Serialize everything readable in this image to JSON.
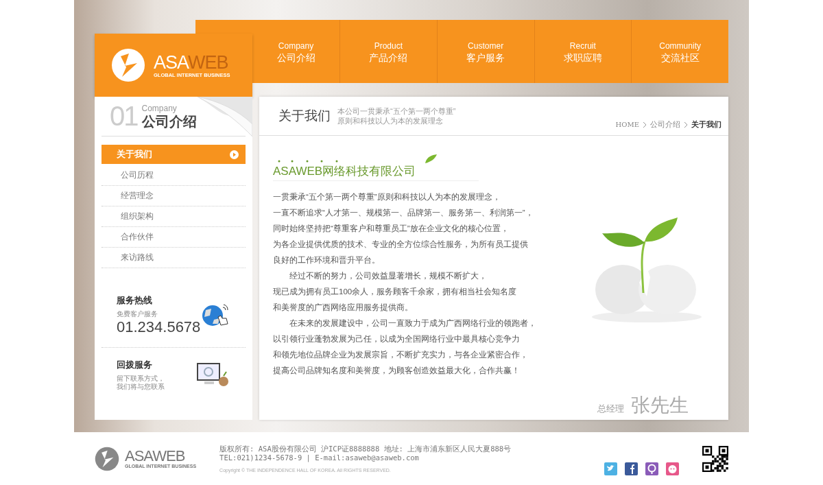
{
  "nav": [
    {
      "en": "Company",
      "zh": "公司介绍"
    },
    {
      "en": "Product",
      "zh": "产品介绍"
    },
    {
      "en": "Customer",
      "zh": "客户服务"
    },
    {
      "en": "Recruit",
      "zh": "求职应聘"
    },
    {
      "en": "Community",
      "zh": "交流社区"
    }
  ],
  "logo": {
    "name_light": "ASA",
    "name_bold": "WEB",
    "tagline": "GLOBAL INTERNET BUSINESS"
  },
  "sidebar": {
    "number": "01",
    "en": "Company",
    "zh": "公司介绍",
    "menu": [
      {
        "label": "关于我们",
        "selected": true
      },
      {
        "label": "公司历程",
        "selected": false
      },
      {
        "label": "经营理念",
        "selected": false
      },
      {
        "label": "组织架构",
        "selected": false
      },
      {
        "label": "合作伙伴",
        "selected": false
      },
      {
        "label": "来访路线",
        "selected": false
      }
    ],
    "hotline": {
      "title": "服务热线",
      "subtitle": "免费客户服务",
      "number": "01.234.5678"
    },
    "callback": {
      "title": "回拨服务",
      "lines": [
        "留下联系方式，",
        "我们将与您联系"
      ]
    }
  },
  "main": {
    "title": "关于我们",
    "subtitle": [
      "本公司一贯秉承“五个第一两个尊重”",
      "原则和科技以人为本的发展理念"
    ],
    "breadcrumb": [
      {
        "label": "HOME",
        "selected": false
      },
      {
        "label": "公司介绍",
        "selected": false
      },
      {
        "label": "关于我们",
        "selected": true
      }
    ],
    "company_name": "ASAWEB网络科技有限公司",
    "lines": [
      {
        "text": "一贯秉承“五个第一两个尊重”原则和科技以人为本的发展理念，",
        "indent": false
      },
      {
        "text": "一直不断追求“人才第一、规模第一、品牌第一、服务第一、利润第一”，",
        "indent": false
      },
      {
        "text": "同时始终坚持把“尊重客户和尊重员工”放在企业文化的核心位置，",
        "indent": false
      },
      {
        "text": "为各企业提供优质的技术、专业的全方位综合性服务，为所有员工提供",
        "indent": false
      },
      {
        "text": "良好的工作环境和晋升平台。",
        "indent": false
      },
      {
        "text": "经过不断的努力，公司效益显著增长，规模不断扩大，",
        "indent": true
      },
      {
        "text": "现已成为拥有员工100余人，服务顾客千余家，拥有相当社会知名度",
        "indent": false
      },
      {
        "text": "和美誉度的广西网络应用服务提供商。",
        "indent": false
      },
      {
        "text": "在未来的发展建设中，公司一直致力于成为广西网络行业的领跑者，",
        "indent": true
      },
      {
        "text": "以引领行业蓬勃发展为己任，以成为全国网络行业中最具核心竞争力",
        "indent": false
      },
      {
        "text": "和领先地位品牌企业为发展宗旨，不断扩充实力，与各企业紧密合作，",
        "indent": false
      },
      {
        "text": "提高公司品牌知名度和美誉度，为顾客创造效益最大化，合作共赢！",
        "indent": false
      }
    ],
    "signature": {
      "role": "总经理",
      "name": "张先生"
    }
  },
  "footer": {
    "logo": {
      "name_light": "ASA",
      "name_bold": "WEB",
      "tagline": "GLOBAL INTERNET BUSINESS"
    },
    "info": "版权所有: ASA股份有限公司 沪ICP证8888888 地址: 上海市浦东新区人民大夏888号",
    "contact": "TEL:021)1234-5678-9 | E-mail:asaweb@asaweb.com",
    "copyright": "Copyright © THE INDEPENDENCE HALL OF KOREA. All RIGHTS RESERVED."
  }
}
